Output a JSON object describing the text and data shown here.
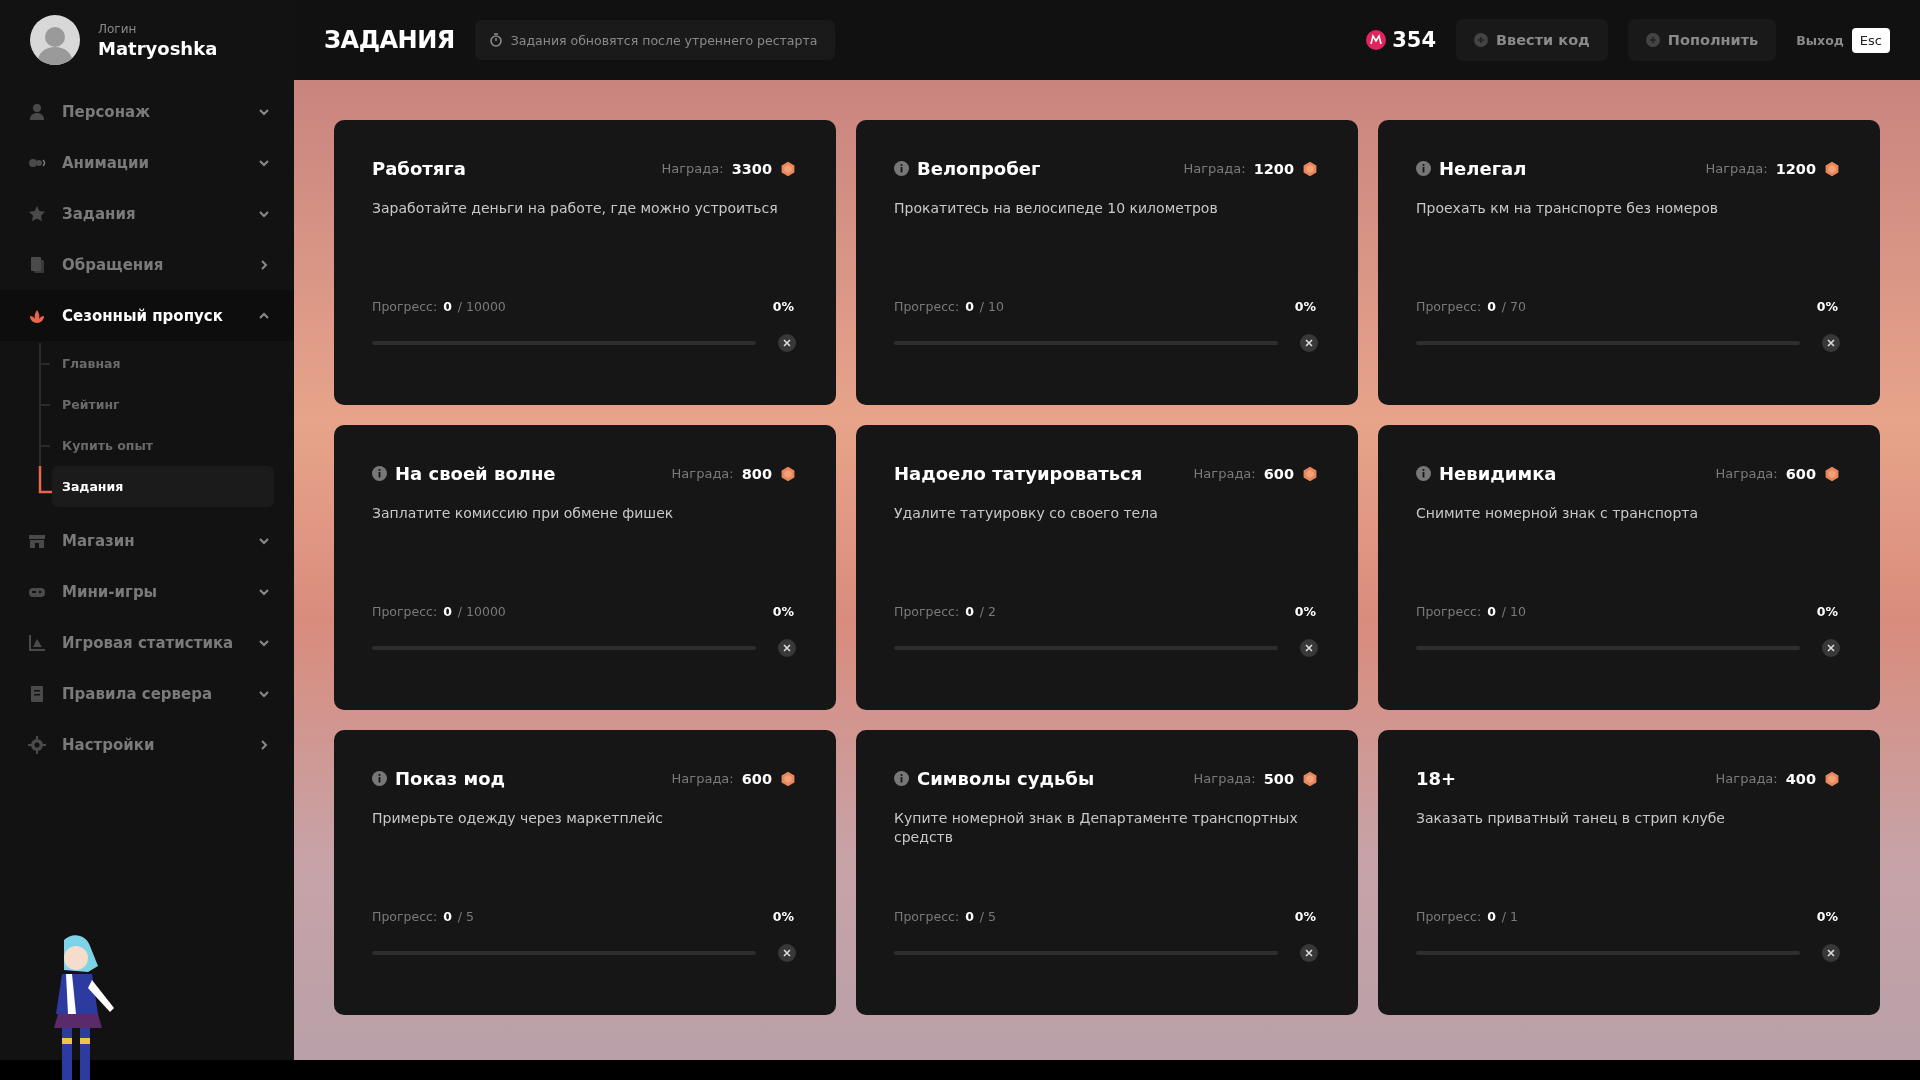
{
  "user": {
    "login_label": "Логин",
    "name": "Matryoshka"
  },
  "header": {
    "title": "ЗАДАНИЯ",
    "notice": "Задания обновятся после утреннего рестарта",
    "balance": "354",
    "buttons": [
      "Ввести код",
      "Пополнить"
    ],
    "exit_label": "Выход",
    "exit_key": "Esc"
  },
  "sidebar": {
    "items": [
      {
        "label": "Персонаж",
        "kind": "dropdown",
        "expanded": false,
        "selected": false
      },
      {
        "label": "Анимации",
        "kind": "dropdown",
        "expanded": false,
        "selected": false
      },
      {
        "label": "Задания",
        "kind": "dropdown",
        "expanded": false,
        "selected": false
      },
      {
        "label": "Обращения",
        "kind": "link",
        "selected": false
      },
      {
        "label": "Сезонный пропуск",
        "kind": "dropdown",
        "expanded": true,
        "selected": true,
        "children": [
          {
            "label": "Главная",
            "selected": false
          },
          {
            "label": "Рейтинг",
            "selected": false
          },
          {
            "label": "Купить опыт",
            "selected": false
          },
          {
            "label": "Задания",
            "selected": true
          }
        ]
      },
      {
        "label": "Магазин",
        "kind": "dropdown",
        "expanded": false,
        "selected": false
      },
      {
        "label": "Мини-игры",
        "kind": "dropdown",
        "expanded": false,
        "selected": false
      },
      {
        "label": "Игровая статистика",
        "kind": "dropdown",
        "expanded": false,
        "selected": false
      },
      {
        "label": "Правила сервера",
        "kind": "dropdown",
        "expanded": false,
        "selected": false
      },
      {
        "label": "Настройки",
        "kind": "link",
        "selected": false
      }
    ]
  },
  "tasks": [
    {
      "title": "Работяга",
      "info": false,
      "reward_label": "Награда:",
      "reward": "3300",
      "description": "Заработайте деньги на работе, где можно устроиться",
      "progress_label": "Прогресс:",
      "done": "0",
      "total": "/ 10000",
      "percent": "0%",
      "level": 0
    },
    {
      "title": "Велопробег",
      "info": true,
      "reward_label": "Награда:",
      "reward": "1200",
      "description": "Прокатитесь на велосипеде 10 километров",
      "progress_label": "Прогресс:",
      "done": "0",
      "total": "/ 10",
      "percent": "0%",
      "level": 0
    },
    {
      "title": "Нелегал",
      "info": true,
      "reward_label": "Награда:",
      "reward": "1200",
      "description": "Проехать км на транспорте без номеров",
      "progress_label": "Прогресс:",
      "done": "0",
      "total": "/ 70",
      "percent": "0%",
      "level": 0
    },
    {
      "title": "На своей волне",
      "info": true,
      "reward_label": "Награда:",
      "reward": "800",
      "description": "Заплатите комиссию при обмене фишек",
      "progress_label": "Прогресс:",
      "done": "0",
      "total": "/ 10000",
      "percent": "0%",
      "level": 0
    },
    {
      "title": "Надоело татуироваться",
      "info": false,
      "reward_label": "Награда:",
      "reward": "600",
      "description": "Удалите татуировку со своего тела",
      "progress_label": "Прогресс:",
      "done": "0",
      "total": "/ 2",
      "percent": "0%",
      "level": 0
    },
    {
      "title": "Невидимка",
      "info": true,
      "reward_label": "Награда:",
      "reward": "600",
      "description": "Снимите номерной знак с транспорта",
      "progress_label": "Прогресс:",
      "done": "0",
      "total": "/ 10",
      "percent": "0%",
      "level": 0
    },
    {
      "title": "Показ мод",
      "info": true,
      "reward_label": "Награда:",
      "reward": "600",
      "description": "Примерьте одежду через маркетплейс",
      "progress_label": "Прогресс:",
      "done": "0",
      "total": "/ 5",
      "percent": "0%",
      "level": 0
    },
    {
      "title": "Символы судьбы",
      "info": true,
      "reward_label": "Награда:",
      "reward": "500",
      "description": "Купите номерной знак в Департаменте транспортных средств",
      "progress_label": "Прогресс:",
      "done": "0",
      "total": "/ 5",
      "percent": "0%",
      "level": 0
    },
    {
      "title": "18+",
      "info": false,
      "reward_label": "Награда:",
      "reward": "400",
      "description": "Заказать приватный танец в стрип клубе",
      "progress_label": "Прогресс:",
      "done": "0",
      "total": "/ 1",
      "percent": "0%",
      "level": 0
    }
  ]
}
